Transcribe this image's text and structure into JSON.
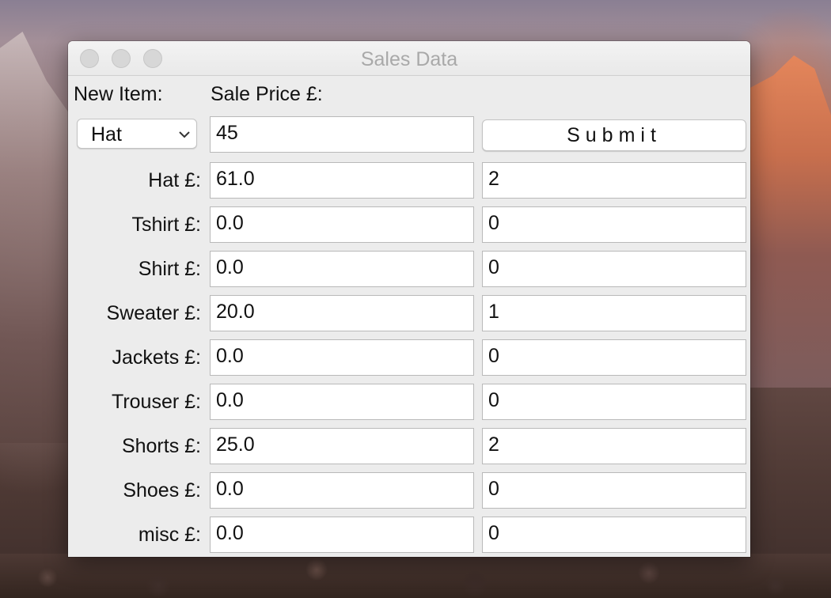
{
  "window": {
    "title": "Sales Data"
  },
  "form": {
    "new_item_label": "New Item:",
    "sale_price_label": "Sale Price £:",
    "selected_item": "Hat",
    "sale_price_value": "45",
    "submit_label": "Submit"
  },
  "rows": [
    {
      "label": "Hat £:",
      "total": "61.0",
      "count": "2"
    },
    {
      "label": "Tshirt £:",
      "total": "0.0",
      "count": "0"
    },
    {
      "label": "Shirt £:",
      "total": "0.0",
      "count": "0"
    },
    {
      "label": "Sweater £:",
      "total": "20.0",
      "count": "1"
    },
    {
      "label": "Jackets £:",
      "total": "0.0",
      "count": "0"
    },
    {
      "label": "Trouser £:",
      "total": "0.0",
      "count": "0"
    },
    {
      "label": "Shorts £:",
      "total": "25.0",
      "count": "2"
    },
    {
      "label": "Shoes £:",
      "total": "0.0",
      "count": "0"
    },
    {
      "label": "misc £:",
      "total": "0.0",
      "count": "0"
    }
  ]
}
